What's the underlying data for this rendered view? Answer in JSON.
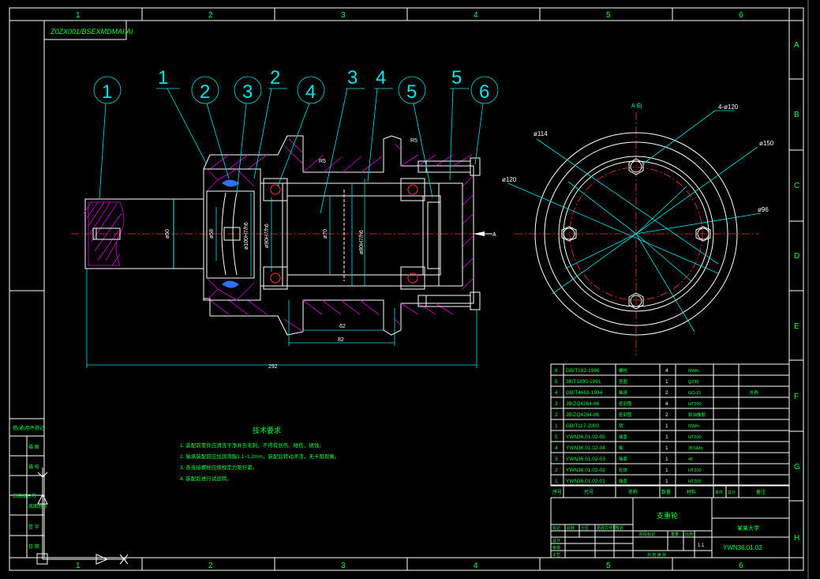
{
  "title_stamp": "Z0ZX001/BSEXMDMAI.AI",
  "border": {
    "columns": [
      "1",
      "2",
      "3",
      "4",
      "5",
      "6"
    ],
    "rows": [
      "A",
      "B",
      "C",
      "D",
      "E",
      "F",
      "G",
      "H"
    ]
  },
  "balloons": [
    "1",
    "2",
    "3",
    "4",
    "5",
    "6"
  ],
  "leader_numbers": [
    "1",
    "2",
    "2",
    "3",
    "4",
    "5"
  ],
  "dimensions": {
    "d50": "ø50",
    "d58": "ø58",
    "d100": "ø100H7/h6",
    "d90": "ø90H7/h6",
    "d70": "ø70",
    "d80": "ø80H7/h6",
    "len62": "62",
    "len82": "82",
    "len292": "292",
    "r5a": "R5",
    "r5b": "R5",
    "view_a_arrow": "A"
  },
  "view_a": {
    "label": "A 向",
    "callouts": [
      "4-ø120",
      "ø114",
      "ø150",
      "ø120",
      "ø96"
    ]
  },
  "tech_notes": {
    "heading": "技术要求",
    "lines": [
      "1. 装配前零件应清洗干净并去毛刺，不得有划伤、碰伤、锈蚀。",
      "2. 轴承装配前应加润滑脂1.1~1.2mm，装配后转动灵活，无卡阻现象。",
      "3. 各连接螺栓应按规定力矩拧紧。",
      "4. 装配后进行试运转。"
    ]
  },
  "bom": [
    {
      "no": "6",
      "code": "GB/T182-1986",
      "name": "螺栓",
      "qty": "4",
      "mat": "65Mn",
      "note": ""
    },
    {
      "no": "5",
      "code": "JB/T1890-1991",
      "name": "垫圈",
      "qty": "1",
      "mat": "Q235",
      "note": ""
    },
    {
      "no": "4",
      "code": "GB/T4663-1994",
      "name": "轴承",
      "qty": "2",
      "mat": "GCr15",
      "note": "外购"
    },
    {
      "no": "3",
      "code": "JB/ZQ4264-86",
      "name": "密封圈",
      "qty": "4",
      "mat": "HT200",
      "note": ""
    },
    {
      "no": "2",
      "code": "JB/ZQ4264-86",
      "name": "密封圈",
      "qty": "2",
      "mat": "耐油橡胶",
      "note": ""
    },
    {
      "no": "1",
      "code": "GB/T117-2000",
      "name": "销",
      "qty": "1",
      "mat": "65Mn",
      "note": ""
    },
    {
      "no": "5",
      "code": "YWN36.01.02-05",
      "name": "端盖",
      "qty": "1",
      "mat": "HT200",
      "note": ""
    },
    {
      "no": "4",
      "code": "YWN36.01.02-04",
      "name": "轴",
      "qty": "1",
      "mat": "35SiMn",
      "note": ""
    },
    {
      "no": "3",
      "code": "YWN36.01.02-03",
      "name": "轴套",
      "qty": "1",
      "mat": "45",
      "note": ""
    },
    {
      "no": "2",
      "code": "YWN36.01.02-02",
      "name": "轮体",
      "qty": "1",
      "mat": "HT200",
      "note": ""
    },
    {
      "no": "1",
      "code": "YWN36.01.02-01",
      "name": "端盖",
      "qty": "1",
      "mat": "HT200",
      "note": ""
    }
  ],
  "bom_header": [
    "序号",
    "代号",
    "名称",
    "数量",
    "材料",
    "单件",
    "总计",
    "备注"
  ],
  "title_block": {
    "assembly_name": "支重轮",
    "company": "某某大学",
    "drawing_no": "YWN36.01.02",
    "scale": "1:1",
    "row_labels": [
      "标记",
      "处数",
      "分区",
      "更改文件号",
      "签名",
      "年月日"
    ],
    "sign_labels": [
      "设计",
      "审核",
      "工艺",
      "批准"
    ],
    "stage_labels": [
      "阶段标记",
      "重量",
      "比例"
    ],
    "sheet": "共 张 第 张"
  },
  "left_strip": [
    "借(通)用件登记",
    "描 图",
    "描 校",
    "旧底图总号",
    "底图总号",
    "签 字",
    "日 期"
  ]
}
